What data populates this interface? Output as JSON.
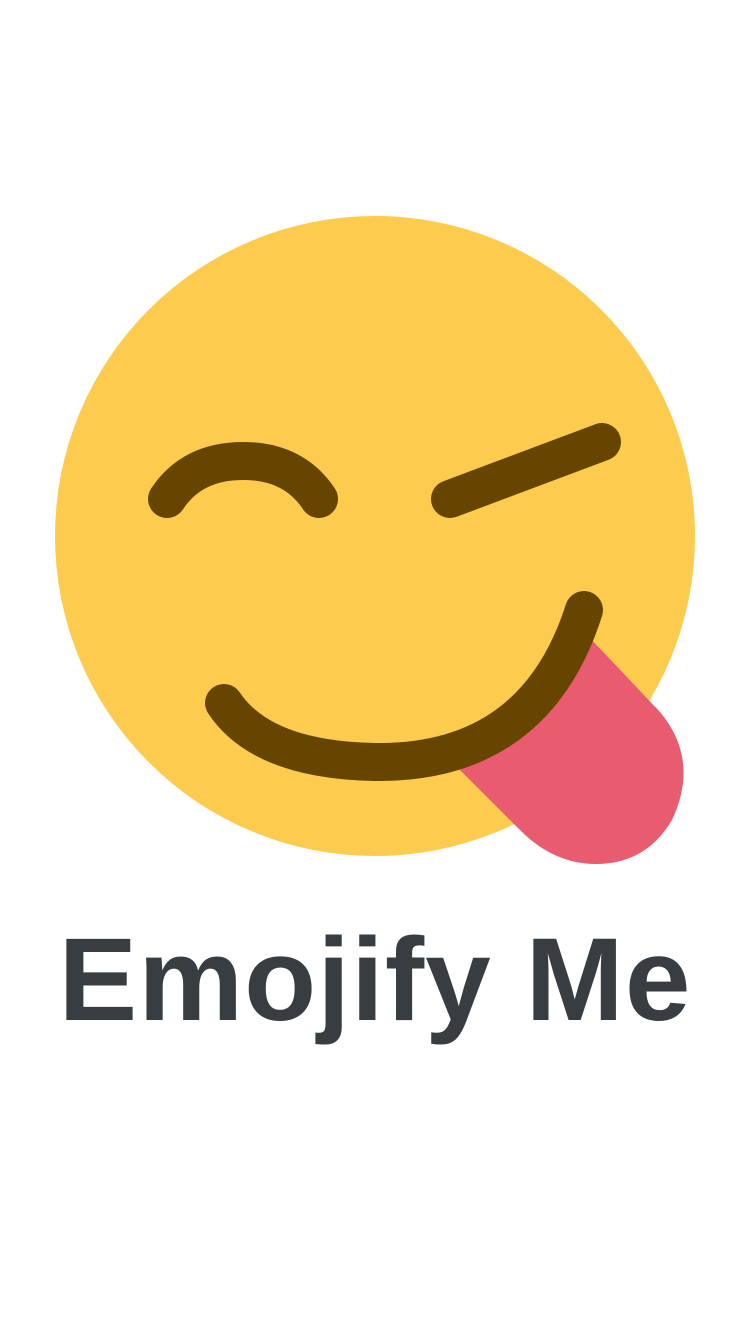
{
  "splash": {
    "logo_icon": "winking-face-with-tongue-icon",
    "title": "Emojify Me"
  },
  "colors": {
    "background": "#ffffff",
    "face": "#FDCB4E",
    "features": "#664500",
    "tongue": "#E95C70",
    "title": "#383D41"
  }
}
